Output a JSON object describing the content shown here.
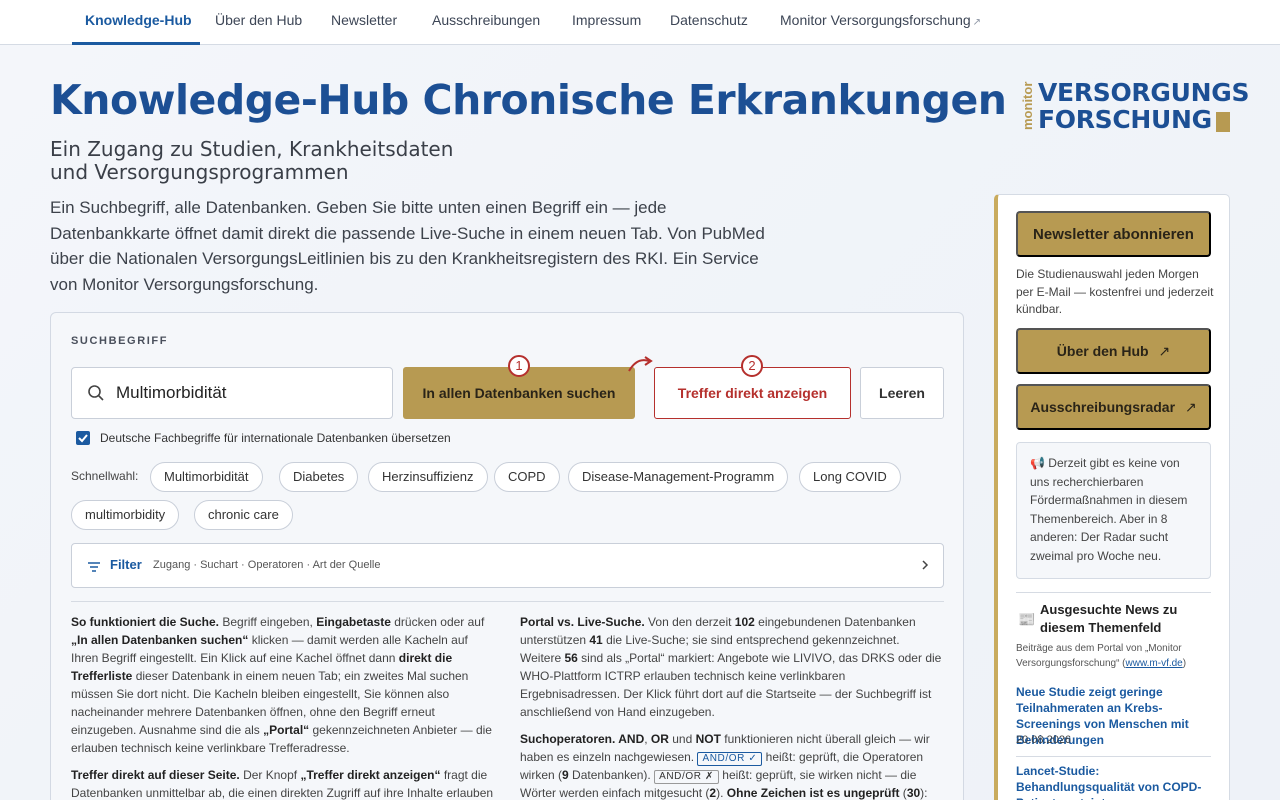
{
  "nav": {
    "items": [
      "Knowledge-Hub",
      "Über den Hub",
      "Newsletter",
      "Ausschreibungen",
      "Impressum",
      "Datenschutz",
      "Monitor Versorgungsforschung"
    ],
    "ext_arrow": "↗"
  },
  "header": {
    "title": "Knowledge-Hub Chronische Erkrankungen",
    "subtitle": "Ein Zugang zu Studien, Krankheitsdaten und Versorgungsprogrammen",
    "intro": "Ein Suchbegriff, alle Datenbanken. Geben Sie bitte unten einen Begriff ein — jede Datenbankkarte öffnet damit direkt die passende Live-Suche in einem neuen Tab. Von PubMed über die Nationalen VersorgungsLeitlinien bis zu den Krankheitsregistern des RKI. Ein Service von Monitor Versorgungsforschung."
  },
  "logo": {
    "small": "monitor",
    "line1": "VERSORGUNGS",
    "line2": "FORSCHUNG"
  },
  "search": {
    "label": "SUCHBEGRIFF",
    "value": "Multimorbidität",
    "btn_all": "In allen Datenbanken suchen",
    "btn_direct": "Treffer direkt anzeigen",
    "btn_clear": "Leeren",
    "step1": "1",
    "step2": "2",
    "translate_label": "Deutsche Fachbegriffe für internationale Datenbanken übersetzen",
    "translate_checked": true,
    "quick_label": "Schnellwahl:",
    "chips": [
      "Multimorbidität",
      "Diabetes",
      "Herzinsuffizienz",
      "COPD",
      "Disease-Management-Programm",
      "Long COVID",
      "multimorbidity",
      "chronic care"
    ],
    "filter_title": "Filter",
    "filter_sub": "Zugang · Suchart · Operatoren · Art der Quelle"
  },
  "help": {
    "left": [
      {
        "b": "So funktioniert die Suche.",
        "t1": " Begriff eingeben, ",
        "b2": "Eingabetaste",
        "t2": " drücken oder auf ",
        "b3": "„In allen Datenbanken suchen“",
        "t3": " klicken — damit werden alle Kacheln auf Ihren Begriff eingestellt. Ein Klick auf eine Kachel öffnet dann ",
        "b4": "direkt die Trefferliste",
        "t4": " dieser Datenbank in einem neuen Tab; ein zweites Mal suchen müssen Sie dort nicht. Die Kacheln bleiben eingestellt, Sie können also nacheinander mehrere Datenbanken öffnen, ohne den Begriff erneut einzugeben. Ausnahme sind die als ",
        "b5": "„Portal“",
        "t5": " gekennzeichneten Anbieter — die erlauben technisch keine verlinkbare Trefferadresse."
      },
      {
        "b": "Treffer direkt auf dieser Seite.",
        "t1": " Der Knopf ",
        "b2": "„Treffer direkt anzeigen“",
        "t2": " fragt die Datenbanken unmittelbar ab, die einen direkten Zugriff auf ihre Inhalte erlauben"
      }
    ],
    "right": {
      "p1_b": "Portal vs. Live-Suche.",
      "p1_t1": " Von den derzeit ",
      "p1_n1": "102",
      "p1_t2": " eingebundenen Datenbanken unterstützen ",
      "p1_n2": "41",
      "p1_t3": " die Live-Suche; sie sind entsprechend gekennzeichnet. Weitere ",
      "p1_n3": "56",
      "p1_t4": " sind als „Portal“ markiert: Angebote wie LIVIVO, das DRKS oder die WHO-Plattform ICTRP erlauben technisch keine verlinkbaren Ergebnisadressen. Der Klick führt dort auf die Startseite — der Suchbegriff ist anschließend von Hand einzugeben.",
      "p2_b": "Suchoperatoren. AND",
      "p2_t1": ", ",
      "p2_b2": "OR",
      "p2_t2": " und ",
      "p2_b3": "NOT",
      "p2_t3": " funktionieren nicht überall gleich — wir haben es einzeln nachgewiesen. ",
      "op1": "AND/OR ✓",
      "p2_t4": " heißt: geprüft, die Operatoren wirken (",
      "p2_n1": "9",
      "p2_t5": " Datenbanken). ",
      "op2": "AND/OR ✗",
      "p2_t6": " heißt: geprüft, sie wirken nicht — die Wörter werden einfach mitgesucht (",
      "p2_n2": "2",
      "p2_t7": "). ",
      "p2_b4": "Ohne Zeichen ist es ungeprüft",
      "p2_t8": " (",
      "p2_n3": "30",
      "p2_t9": "):"
    }
  },
  "sidebar": {
    "newsletter_btn": "Newsletter abonnieren",
    "newsletter_note": "Die Studienauswahl jeden Morgen per E-Mail — kostenfrei und jederzeit kündbar.",
    "about_btn": "Über den Hub",
    "radar_btn": "Ausschreibungsradar",
    "ext_arrow": "↗",
    "notice_icon": "📢",
    "notice": "Derzeit gibt es keine von uns recherchierbaren Fördermaßnahmen in diesem Themenbereich. Aber in 8 anderen: Der Radar sucht zweimal pro Woche neu.",
    "news_icon": "📰",
    "news_title": "Ausgesuchte News zu diesem Themenfeld",
    "news_desc_pre": "Beiträge aus dem Portal von „Monitor Versorgungsforschung“ (",
    "news_desc_link": "www.m-vf.de",
    "news_desc_post": ")",
    "news": [
      {
        "title": "Neue Studie zeigt geringe Teilnahmeraten an Krebs-Screenings von Menschen mit Behinderungen",
        "date": "20.08.2026"
      },
      {
        "title": "Lancet-Studie: Behandlungsqualität von COPD-Patienten steigt",
        "date": ""
      }
    ]
  },
  "colors": {
    "brand_blue": "#1c4f94",
    "gold": "#b79a52",
    "red": "#b5302d"
  }
}
